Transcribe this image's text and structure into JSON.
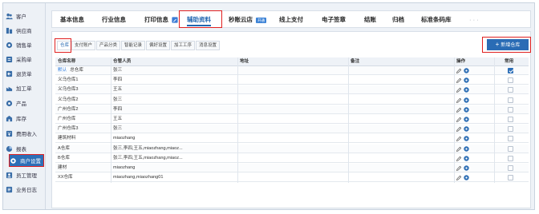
{
  "sidebar": {
    "items": [
      {
        "label": "客户",
        "icon": "people-icon"
      },
      {
        "label": "供应商",
        "icon": "supplier-icon"
      },
      {
        "label": "销售单",
        "icon": "sales-icon"
      },
      {
        "label": "采购单",
        "icon": "purchase-icon"
      },
      {
        "label": "退货单",
        "icon": "return-icon"
      },
      {
        "label": "加工单",
        "icon": "process-icon"
      },
      {
        "label": "产品",
        "icon": "product-icon"
      },
      {
        "label": "库存",
        "icon": "stock-icon"
      },
      {
        "label": "费用收入",
        "icon": "expense-icon"
      },
      {
        "label": "报表",
        "icon": "report-icon"
      },
      {
        "label": "商户设置",
        "icon": "settings-icon",
        "active": true
      },
      {
        "label": "员工管理",
        "icon": "staff-icon"
      },
      {
        "label": "业务日志",
        "icon": "log-icon"
      }
    ]
  },
  "tabs": {
    "basic": "基本信息",
    "industry": "行业信息",
    "print": "打印信息",
    "aux": "辅助资料",
    "shop": "秒账云店",
    "shop_badge": "开通",
    "pay": "线上支付",
    "seal": "电子签章",
    "settle": "结账",
    "archive": "归档",
    "barcode": "标准条码库",
    "more": "· · ·"
  },
  "subtabs": [
    "仓库",
    "支付账户",
    "产品分类",
    "智能记录",
    "偏好设置",
    "加工工序",
    "消息设置"
  ],
  "add_button": {
    "plus": "+",
    "label": "新增仓库"
  },
  "table": {
    "headers": {
      "name": "仓库名称",
      "staff": "仓管人员",
      "address": "地址",
      "remark": "备注",
      "action": "操作",
      "common": "常用"
    },
    "default_tag": "默认",
    "rows": [
      {
        "name": "总仓库",
        "staff": "张三",
        "address": "",
        "remark": "",
        "default": true,
        "common": true
      },
      {
        "name": "义乌仓库1",
        "staff": "李四",
        "address": "",
        "remark": "",
        "common": false
      },
      {
        "name": "义乌仓库3",
        "staff": "王五",
        "address": "",
        "remark": "",
        "common": false
      },
      {
        "name": "义乌仓库2",
        "staff": "张三",
        "address": "",
        "remark": "",
        "common": false
      },
      {
        "name": "广州仓库2",
        "staff": "李四",
        "address": "",
        "remark": "",
        "common": false
      },
      {
        "name": "广州仓库",
        "staff": "王五",
        "address": "",
        "remark": "",
        "common": false
      },
      {
        "name": "广州仓库3",
        "staff": "张三",
        "address": "",
        "remark": "",
        "common": false
      },
      {
        "name": "建筑材料",
        "staff": "miaozhang",
        "address": "",
        "remark": "",
        "common": false
      },
      {
        "name": "A仓库",
        "staff": "张三,李四,王五,miaozhang,miaoz...",
        "address": "",
        "remark": "",
        "common": false
      },
      {
        "name": "B仓库",
        "staff": "张三,李四,王五,miaozhang,miaoz...",
        "address": "",
        "remark": "",
        "common": false
      },
      {
        "name": "建材",
        "staff": "miaozhang",
        "address": "",
        "remark": "",
        "common": false
      },
      {
        "name": "XX仓库",
        "staff": "miaozhang,miaozhang01",
        "address": "",
        "remark": "",
        "common": false
      }
    ]
  },
  "colors": {
    "accent": "#2d6fb7",
    "highlight": "#e02020",
    "link": "#2f7de0"
  }
}
